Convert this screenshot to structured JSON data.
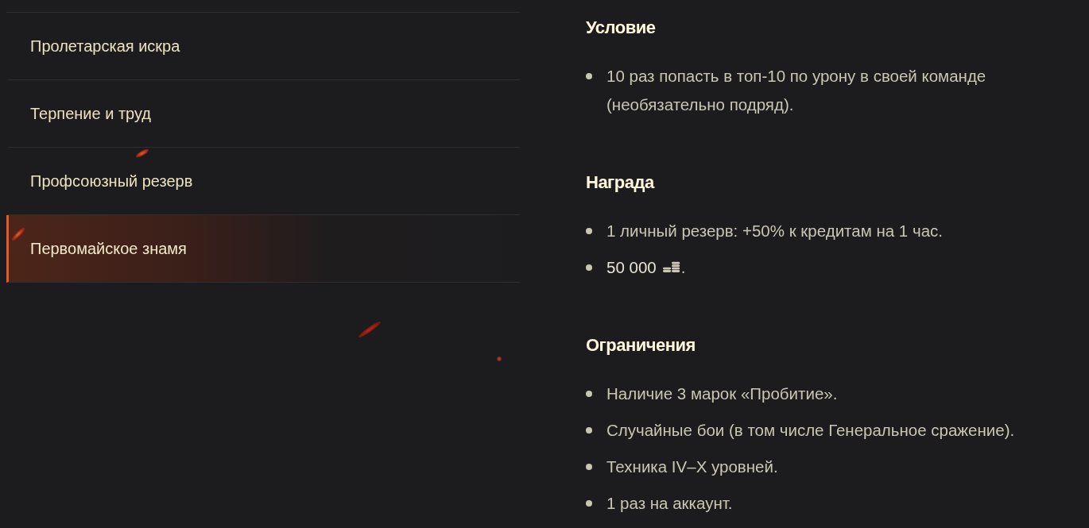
{
  "missions": [
    {
      "label": "Пролетарская искра",
      "selected": false
    },
    {
      "label": "Терпение и труд",
      "selected": false
    },
    {
      "label": "Профсоюзный резерв",
      "selected": false
    },
    {
      "label": "Первомайское знамя",
      "selected": true
    }
  ],
  "sections": [
    {
      "heading": "Условие",
      "items": [
        {
          "kind": "text",
          "text": "10 раз попасть в топ-10 по урону в своей команде (необязательно подряд)."
        }
      ]
    },
    {
      "heading": "Награда",
      "items": [
        {
          "kind": "text",
          "text": "1 личный резерв: +50% к кредитам на 1 час."
        },
        {
          "kind": "credits",
          "amount": "50 000",
          "suffix": "."
        }
      ]
    },
    {
      "heading": "Ограничения",
      "items": [
        {
          "kind": "text",
          "text": "Наличие 3 марок «Пробитие»."
        },
        {
          "kind": "text",
          "text": "Случайные бои (в том числе Генеральное сражение)."
        },
        {
          "kind": "text",
          "text": "Техника IV–X уровней."
        },
        {
          "kind": "text",
          "text": "1 раз на аккаунт."
        }
      ]
    }
  ]
}
